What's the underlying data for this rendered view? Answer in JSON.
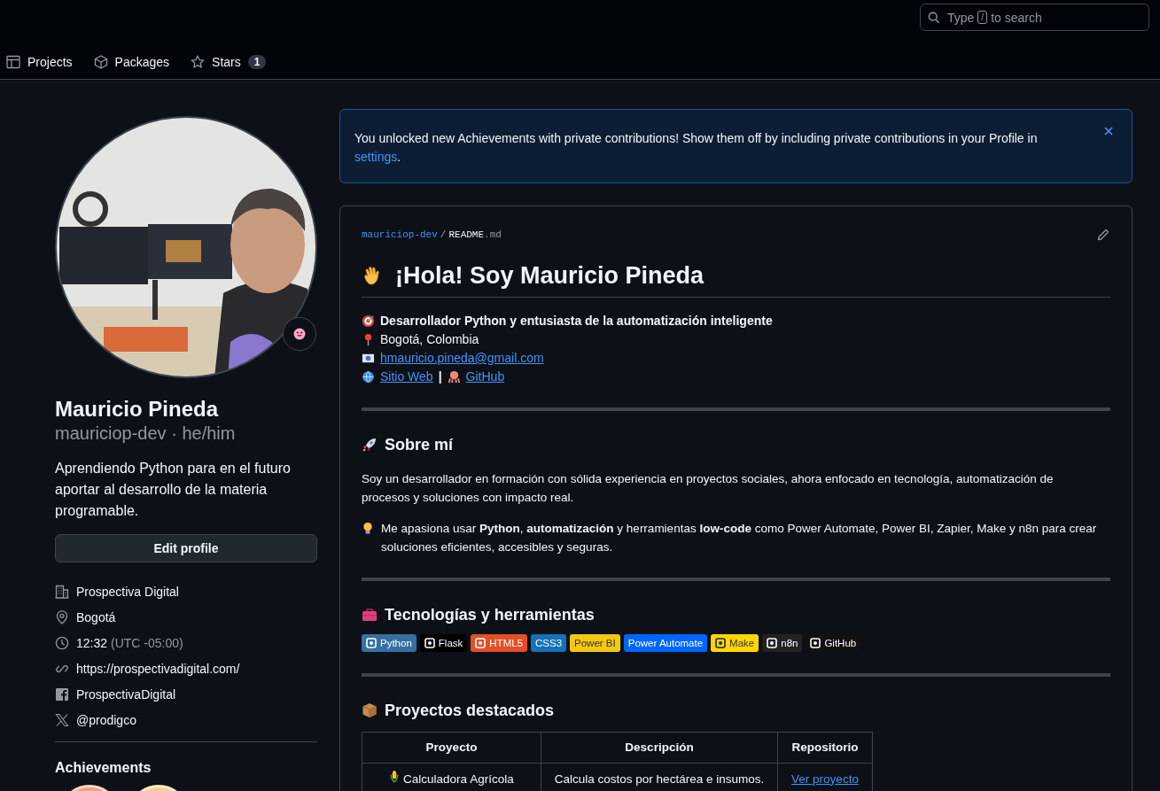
{
  "search": {
    "placeholder_before": "Type",
    "key": "/",
    "placeholder_after": "to search"
  },
  "nav": [
    {
      "label": "Projects",
      "kind": "projects",
      "selected": false
    },
    {
      "label": "Packages",
      "kind": "packages",
      "selected": false
    },
    {
      "label": "Stars",
      "kind": "stars",
      "count": "1",
      "selected": false
    }
  ],
  "profile": {
    "name": "Mauricio Pineda",
    "handle": "mauriciop-dev · he/him",
    "bio": "Aprendiendo Python para en el futuro aportar al desarrollo de la materia programable.",
    "edit_button": "Edit profile",
    "details": [
      {
        "kind": "org",
        "text": "Prospectiva Digital"
      },
      {
        "kind": "location",
        "text": "Bogotá"
      },
      {
        "kind": "time",
        "text": "12:32",
        "secondary": "(UTC -05:00)"
      },
      {
        "kind": "link",
        "text": "https://prospectivadigital.com/"
      },
      {
        "kind": "facebook",
        "text": "ProspectivaDigital"
      },
      {
        "kind": "x",
        "text": "@prodigco"
      }
    ],
    "achievements_title": "Achievements"
  },
  "notice": {
    "text": "You unlocked new Achievements with private contributions! Show them off by including private contributions in your Profile in",
    "link": "settings",
    "after": "."
  },
  "readme": {
    "owner": "mauriciop-dev",
    "separator": "/",
    "file": "README",
    "ext": ".md",
    "title": "¡Hola! Soy Mauricio Pineda",
    "intro": [
      {
        "parts": [
          {
            "text": "Desarrollador Python y entusiasta de la automatización inteligente",
            "kind": "bold"
          }
        ]
      },
      {
        "parts": [
          {
            "text": "Bogotá, Colombia",
            "kind": "text"
          }
        ]
      },
      {
        "parts": [
          {
            "text": "hmauricio.pineda@gmail.com",
            "kind": "link"
          }
        ]
      },
      {
        "parts": [
          {
            "text": "Sitio Web",
            "kind": "link"
          },
          {
            "text": "|",
            "kind": "bold"
          },
          {
            "text": "GitHub",
            "kind": "link"
          }
        ]
      }
    ],
    "sections": [
      {
        "heading": "Sobre mí",
        "paragraphs": [
          "Soy un desarrollador en formación con sólida experiencia en proyectos sociales, ahora enfocado en tecnología, automatización de procesos y soluciones con impacto real.",
          "Me apasiona usar **Python**, **automatización** y herramientas **low-code** como Power Automate, Power BI, Zapier, Make y n8n para crear soluciones eficientes, accesibles y seguras."
        ]
      },
      {
        "heading": "Tecnologías y herramientas",
        "badges": [
          {
            "label": "Python",
            "color": "#3670a0",
            "kind": "logo"
          },
          {
            "label": "Flask",
            "color": "#000000",
            "kind": "logo"
          },
          {
            "label": "HTML5",
            "color": "#e34f26",
            "kind": "logo"
          },
          {
            "label": "CSS3",
            "color": "#1572b6",
            "kind": "plain"
          },
          {
            "label": "Power BI",
            "color": "#f2c811",
            "kind": "plain"
          },
          {
            "label": "Power Automate",
            "color": "#0066ff",
            "kind": "plain"
          },
          {
            "label": "Make",
            "color": "#ffd700",
            "kind": "logo"
          },
          {
            "label": "n8n",
            "color": "#222222",
            "kind": "logo"
          },
          {
            "label": "GitHub",
            "color": "#121011",
            "kind": "logo"
          }
        ]
      },
      {
        "heading": "Proyectos destacados",
        "table": {
          "columns": [
            "Proyecto",
            "Descripción",
            "Repositorio"
          ],
          "rows": [
            {
              "project": "Calculadora Agrícola",
              "description": "Calcula costos por hectárea e insumos.",
              "link": "Ver proyecto"
            }
          ]
        }
      }
    ]
  }
}
